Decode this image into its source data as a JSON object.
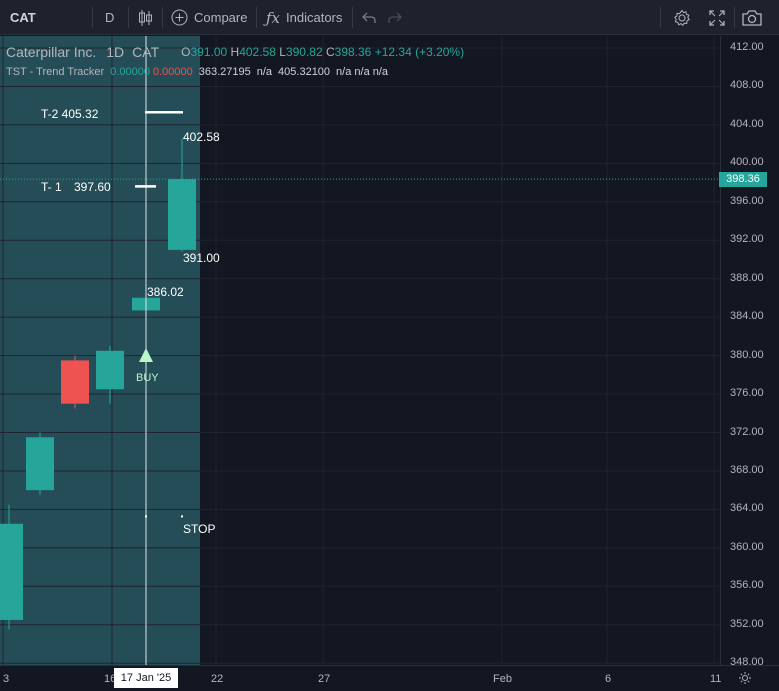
{
  "toolbar": {
    "symbol": "CAT",
    "interval": "D",
    "compare_label": "Compare",
    "indicators_label": "Indicators"
  },
  "legend": {
    "title": "Caterpillar Inc.",
    "interval": "1D",
    "ticker": "CAT",
    "o_key": "O",
    "o_val": "391.00",
    "h_key": "H",
    "h_val": "402.58",
    "l_key": "L",
    "l_val": "390.82",
    "c_key": "C",
    "c_val": "398.36",
    "change": "+12.34 (+3.20%)",
    "indicator_name": "TST - Trend Tracker",
    "ind_v1": "0.00000",
    "ind_v2": "0.00000",
    "ind_v3": "363.27195",
    "ind_v4": "n/a",
    "ind_v5": "405.32100",
    "ind_v6": "n/a n/a n/a"
  },
  "annotations": {
    "t2": "T-2 405.32",
    "t1_prefix": "T- 1",
    "t1_value": "397.60",
    "high": "402.58",
    "low": "391.00",
    "entry": "386.02",
    "buy": "BUY",
    "stop": "STOP"
  },
  "price_scale": {
    "ticks": [
      "412.00",
      "408.00",
      "404.00",
      "400.00",
      "396.00",
      "392.00",
      "388.00",
      "384.00",
      "380.00",
      "376.00",
      "372.00",
      "368.00",
      "364.00",
      "360.00",
      "356.00",
      "352.00",
      "348.00"
    ],
    "current_price": "398.36"
  },
  "time_scale": {
    "ticks": [
      "3",
      "16",
      "22",
      "27",
      "Feb",
      "6",
      "11"
    ],
    "crosshair_date": "17 Jan '25"
  },
  "chart_data": {
    "type": "candlestick",
    "symbol": "CAT",
    "interval": "1D",
    "ylim": [
      348,
      414
    ],
    "candles": [
      {
        "open": 352.5,
        "high": 364.5,
        "low": 351.5,
        "close": 362.5
      },
      {
        "open": 366.0,
        "high": 372.0,
        "low": 365.5,
        "close": 371.5
      },
      {
        "open": 379.5,
        "high": 380.0,
        "low": 374.5,
        "close": 375.0
      },
      {
        "open": 376.5,
        "high": 381.0,
        "low": 375.0,
        "close": 380.5
      },
      {
        "open": 384.7,
        "high": 386.02,
        "low": 380.6,
        "close": 386.02
      },
      {
        "open": 391.0,
        "high": 402.58,
        "low": 390.82,
        "close": 398.36
      }
    ],
    "targets": {
      "T-2": 405.32,
      "T-1": 397.6
    },
    "stop": 363.27,
    "colors": {
      "up": "#26a69a",
      "down": "#ef5350",
      "highlight": "#27525c",
      "background": "#131722"
    }
  }
}
